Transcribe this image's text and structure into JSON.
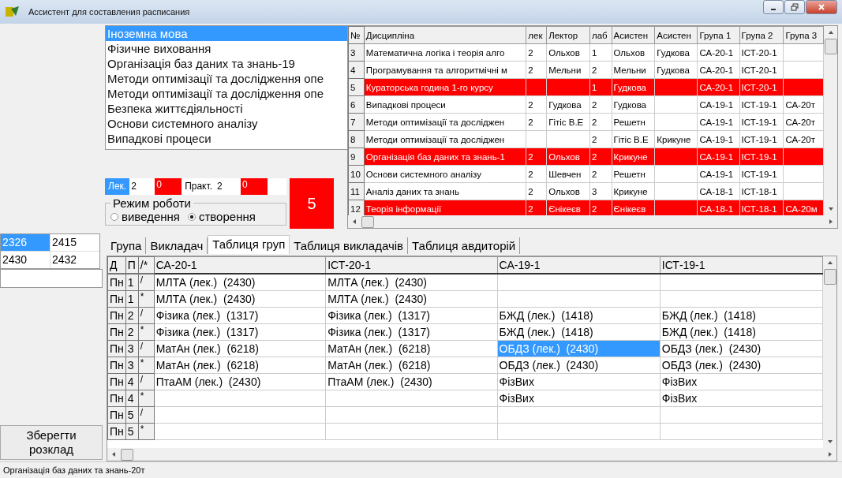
{
  "window": {
    "title": "Ассистент для составления расписания"
  },
  "discipline_list": {
    "items": [
      {
        "label": "Іноземна мова",
        "selected": true
      },
      {
        "label": "Фізичне виховання",
        "selected": false
      },
      {
        "label": "Організація баз даних та знань-19",
        "selected": false
      },
      {
        "label": "Методи оптимізації та дослідження опе",
        "selected": false
      },
      {
        "label": "Методи оптимізації та дослідження опе",
        "selected": false
      },
      {
        "label": "Безпека життєдіяльності",
        "selected": false
      },
      {
        "label": "Основи системного аналізу",
        "selected": false
      },
      {
        "label": "Випадкові процеси",
        "selected": false
      }
    ]
  },
  "counters": [
    {
      "label": "Лек.",
      "value": "2",
      "remaining": "0",
      "selected": true
    },
    {
      "label": "Практ.",
      "value": "2",
      "remaining": "0",
      "selected": false
    }
  ],
  "total": "5",
  "mode": {
    "title": "Режим роботи",
    "options": [
      {
        "label": "виведення",
        "selected": false
      },
      {
        "label": "створення",
        "selected": true
      }
    ]
  },
  "disciplines": {
    "columns": [
      "№",
      "Дисципліна",
      "лек",
      "Лектор",
      "лаб",
      "Асистен",
      "Асистен",
      "Група 1",
      "Група 2",
      "Група 3"
    ],
    "rows": [
      {
        "highlighted": false,
        "cells": [
          "3",
          "Математична логіка і теорія алго",
          "2",
          "Ольхов",
          "1",
          "Ольхов",
          "Гудкова",
          "СА-20-1",
          "ІСТ-20-1",
          ""
        ]
      },
      {
        "highlighted": false,
        "cells": [
          "4",
          "Програмування та алгоритмічні м",
          "2",
          "Мельни",
          "2",
          "Мельни",
          "Гудкова",
          "СА-20-1",
          "ІСТ-20-1",
          ""
        ]
      },
      {
        "highlighted": true,
        "cells": [
          "5",
          "Кураторська година 1-го курсу",
          "",
          "",
          "1",
          "Гудкова",
          "",
          "СА-20-1",
          "ІСТ-20-1",
          ""
        ]
      },
      {
        "highlighted": false,
        "cells": [
          "6",
          "Випадкові процеси",
          "2",
          "Гудкова",
          "2",
          "Гудкова",
          "",
          "СА-19-1",
          "ІСТ-19-1",
          "СА-20т"
        ]
      },
      {
        "highlighted": false,
        "cells": [
          "7",
          "Методи оптимізації та досліджен",
          "2",
          "Гітіс В.Е",
          "2",
          "Решетн",
          "",
          "СА-19-1",
          "ІСТ-19-1",
          "СА-20т"
        ]
      },
      {
        "highlighted": false,
        "cells": [
          "8",
          "Методи оптимізації та досліджен",
          "",
          "",
          "2",
          "Гітіс В.Е",
          "Крикуне",
          "СА-19-1",
          "ІСТ-19-1",
          "СА-20т"
        ]
      },
      {
        "highlighted": true,
        "cells": [
          "9",
          "Організація баз даних та знань-1",
          "2",
          "Ольхов",
          "2",
          "Крикуне",
          "",
          "СА-19-1",
          "ІСТ-19-1",
          ""
        ]
      },
      {
        "highlighted": false,
        "cells": [
          "10",
          "Основи системного аналізу",
          "2",
          "Шевчен",
          "2",
          "Решетн",
          "",
          "СА-19-1",
          "ІСТ-19-1",
          ""
        ]
      },
      {
        "highlighted": false,
        "cells": [
          "11",
          "Аналіз даних та знань",
          "2",
          "Ольхов",
          "3",
          "Крикуне",
          "",
          "СА-18-1",
          "ІСТ-18-1",
          ""
        ]
      },
      {
        "highlighted": true,
        "cells": [
          "12",
          "Теорія інформації",
          "2",
          "Єнікеєв",
          "2",
          "Єнікеєв",
          "",
          "СА-18-1",
          "ІСТ-18-1",
          "СА-20м"
        ]
      }
    ]
  },
  "rooms": [
    {
      "label": "2326",
      "selected": true
    },
    {
      "label": "2415",
      "selected": false
    },
    {
      "label": "2430",
      "selected": false
    },
    {
      "label": "2432",
      "selected": false
    }
  ],
  "save_button": "Зберегти розклад",
  "tabs": [
    {
      "label": "Група",
      "selected": false
    },
    {
      "label": "Викладач",
      "selected": false
    },
    {
      "label": "Таблиця груп",
      "selected": true
    },
    {
      "label": "Таблиця викладачів",
      "selected": false
    },
    {
      "label": "Таблиця авдиторій",
      "selected": false
    }
  ],
  "schedule": {
    "key_columns": [
      "Д",
      "П",
      "/*"
    ],
    "group_columns": [
      "СА-20-1",
      "ІСТ-20-1",
      "СА-19-1",
      "ІСТ-19-1"
    ],
    "rows": [
      {
        "day": "Пн",
        "pair": "1",
        "week": "/",
        "cells": [
          {
            "text": "МЛТА (лек.)  (2430)",
            "selected": false
          },
          {
            "text": "МЛТА (лек.)  (2430)",
            "selected": false
          },
          {
            "selected": false
          },
          {
            "selected": false
          }
        ]
      },
      {
        "day": "Пн",
        "pair": "1",
        "week": "*",
        "cells": [
          {
            "text": "МЛТА (лек.)  (2430)",
            "selected": false
          },
          {
            "text": "МЛТА (лек.)  (2430)",
            "selected": false
          },
          {
            "selected": false
          },
          {
            "selected": false
          }
        ]
      },
      {
        "day": "Пн",
        "pair": "2",
        "week": "/",
        "cells": [
          {
            "text": "Фізика (лек.)  (1317)",
            "selected": false
          },
          {
            "text": "Фізика (лек.)  (1317)",
            "selected": false
          },
          {
            "text": "БЖД (лек.)  (1418)",
            "selected": false
          },
          {
            "text": "БЖД (лек.)  (1418)",
            "selected": false
          }
        ]
      },
      {
        "day": "Пн",
        "pair": "2",
        "week": "*",
        "cells": [
          {
            "text": "Фізика (лек.)  (1317)",
            "selected": false
          },
          {
            "text": "Фізика (лек.)  (1317)",
            "selected": false
          },
          {
            "text": "БЖД (лек.)  (1418)",
            "selected": false
          },
          {
            "text": "БЖД (лек.)  (1418)",
            "selected": false
          }
        ]
      },
      {
        "day": "Пн",
        "pair": "3",
        "week": "/",
        "cells": [
          {
            "text": "МатАн (лек.)  (6218)",
            "selected": false
          },
          {
            "text": "МатАн (лек.)  (6218)",
            "selected": false
          },
          {
            "text": "ОБДЗ (лек.)  (2430)",
            "selected": true
          },
          {
            "text": "ОБДЗ (лек.)  (2430)",
            "selected": false
          }
        ]
      },
      {
        "day": "Пн",
        "pair": "3",
        "week": "*",
        "cells": [
          {
            "text": "МатАн (лек.)  (6218)",
            "selected": false
          },
          {
            "text": "МатАн (лек.)  (6218)",
            "selected": false
          },
          {
            "text": "ОБДЗ (лек.)  (2430)",
            "selected": false
          },
          {
            "text": "ОБДЗ (лек.)  (2430)",
            "selected": false
          }
        ]
      },
      {
        "day": "Пн",
        "pair": "4",
        "week": "/",
        "cells": [
          {
            "text": "ПтаАМ (лек.)  (2430)",
            "selected": false
          },
          {
            "text": "ПтаАМ (лек.)  (2430)",
            "selected": false
          },
          {
            "text": "ФізВих",
            "selected": false
          },
          {
            "text": "ФізВих",
            "selected": false
          }
        ]
      },
      {
        "day": "Пн",
        "pair": "4",
        "week": "*",
        "cells": [
          {
            "selected": false
          },
          {
            "selected": false
          },
          {
            "text": "ФізВих",
            "selected": false
          },
          {
            "text": "ФізВих",
            "selected": false
          }
        ]
      },
      {
        "day": "Пн",
        "pair": "5",
        "week": "/",
        "cells": [
          {
            "selected": false
          },
          {
            "selected": false
          },
          {
            "selected": false
          },
          {
            "selected": false
          }
        ]
      },
      {
        "day": "Пн",
        "pair": "5",
        "week": "*",
        "cells": [
          {
            "selected": false
          },
          {
            "selected": false
          },
          {
            "selected": false
          },
          {
            "selected": false
          }
        ]
      }
    ]
  },
  "status_bar": "Організація баз даних та знань-20т"
}
